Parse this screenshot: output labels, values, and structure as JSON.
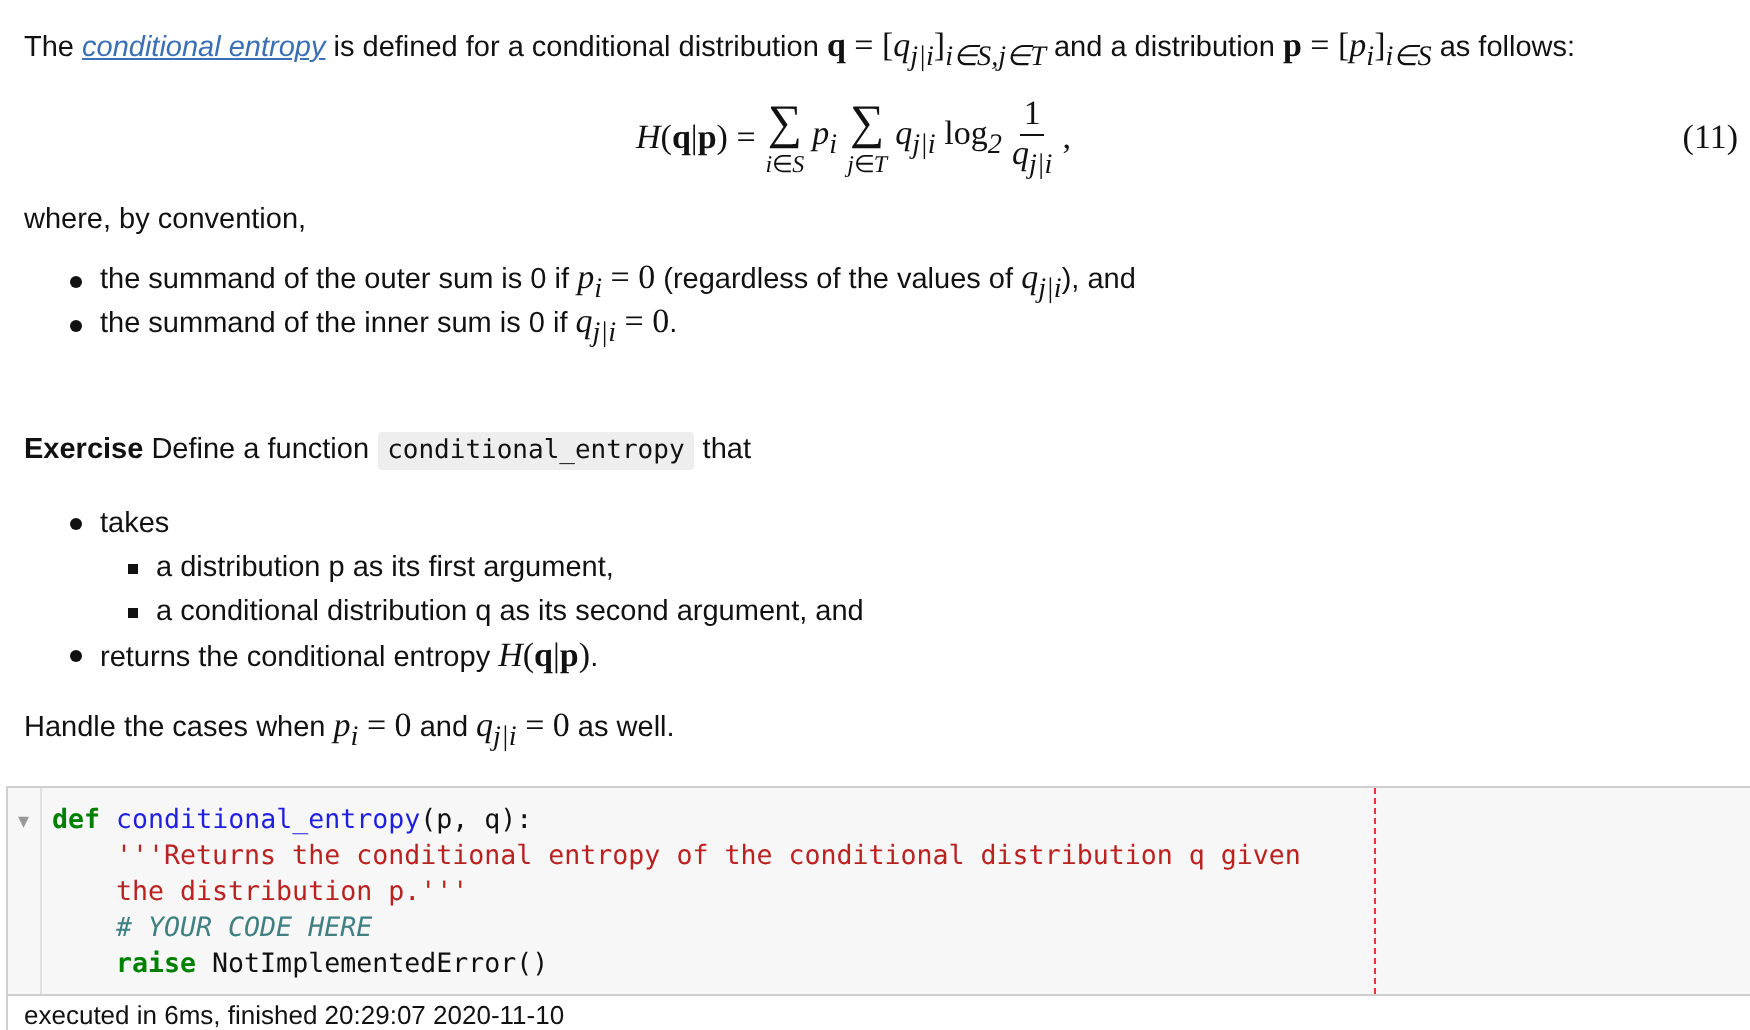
{
  "intro": [
    {
      "kind": "text",
      "text": "The "
    },
    {
      "kind": "link",
      "text": "conditional entropy"
    },
    {
      "kind": "text",
      "text": " is defined for a conditional distribution "
    },
    {
      "kind": "math",
      "text": "**q** = [*q*$_{j|i}$]$_{i∈S,j∈T}$"
    },
    {
      "kind": "text",
      "text": " and a distribution "
    },
    {
      "kind": "math",
      "text": "**p** = [*p*$_{i}$]$_{i∈S}$"
    },
    {
      "kind": "text",
      "text": " as follows:"
    }
  ],
  "equation": {
    "lhs": "*H*(**q**|**p**) =",
    "sums": [
      {
        "symbol": "∑",
        "under": "*i*∈*S*",
        "term": "*p*$_{i}$"
      },
      {
        "symbol": "∑",
        "under": "*j*∈*T*",
        "term": "*q*$_{j|i}$ log$_{2}$"
      }
    ],
    "numerator": "1",
    "denominator": "*q*$_{j|i}$",
    "trailing": ",",
    "number": "(11)"
  },
  "convention": "where, by convention,",
  "rules": [
    {
      "segments": [
        {
          "kind": "text",
          "text": "the summand of the outer sum is 0 if "
        },
        {
          "kind": "math",
          "text": "*p*$_{i}$ = 0"
        },
        {
          "kind": "text",
          "text": " (regardless of the values of "
        },
        {
          "kind": "math",
          "text": "*q*$_{j|i}$"
        },
        {
          "kind": "text",
          "text": "), and"
        }
      ]
    },
    {
      "segments": [
        {
          "kind": "text",
          "text": "the summand of the inner sum is 0 if "
        },
        {
          "kind": "math",
          "text": "*q*$_{j|i}$ = 0"
        },
        {
          "kind": "text",
          "text": "."
        }
      ]
    }
  ],
  "exercise": [
    {
      "kind": "text",
      "text": "**Exercise** Define a function "
    },
    {
      "kind": "code",
      "text": "conditional_entropy"
    },
    {
      "kind": "text",
      "text": " that"
    }
  ],
  "tasks": [
    {
      "segments": [
        {
          "kind": "text",
          "text": "takes"
        }
      ],
      "children": [
        "a distribution p as its first argument,",
        "a conditional distribution q as its second argument, and"
      ]
    },
    {
      "segments": [
        {
          "kind": "text",
          "text": "returns the conditional entropy "
        },
        {
          "kind": "math",
          "text": "*H*(**q**|**p**)"
        },
        {
          "kind": "text",
          "text": "."
        }
      ]
    }
  ],
  "handle": [
    {
      "kind": "text",
      "text": "Handle the cases when "
    },
    {
      "kind": "math",
      "text": "*p*$_{i}$ = 0"
    },
    {
      "kind": "text",
      "text": " and "
    },
    {
      "kind": "math",
      "text": "*q*$_{j|i}$ = 0"
    },
    {
      "kind": "text",
      "text": " as well."
    }
  ],
  "cell": {
    "collapse_toggle": "▾",
    "lines": [
      {
        "indented": false,
        "tokens": [
          {
            "kind": "keyword",
            "text": "def"
          },
          {
            "kind": "name",
            "text": " conditional_entropy"
          },
          {
            "kind": "plain",
            "text": "(p, q):"
          }
        ]
      },
      {
        "indented": true,
        "tokens": [
          {
            "kind": "string",
            "text": "'''Returns the conditional entropy of the conditional distribution q given"
          }
        ]
      },
      {
        "indented": true,
        "tokens": [
          {
            "kind": "string",
            "text": "the distribution p.'''"
          }
        ]
      },
      {
        "indented": true,
        "tokens": [
          {
            "kind": "comment",
            "text": "# YOUR CODE HERE"
          }
        ]
      },
      {
        "indented": true,
        "tokens": [
          {
            "kind": "keyword",
            "text": "raise"
          },
          {
            "kind": "plain",
            "text": " NotImplementedError()"
          }
        ]
      }
    ],
    "output": "executed in 6ms, finished 20:29:07 2020-11-10"
  }
}
